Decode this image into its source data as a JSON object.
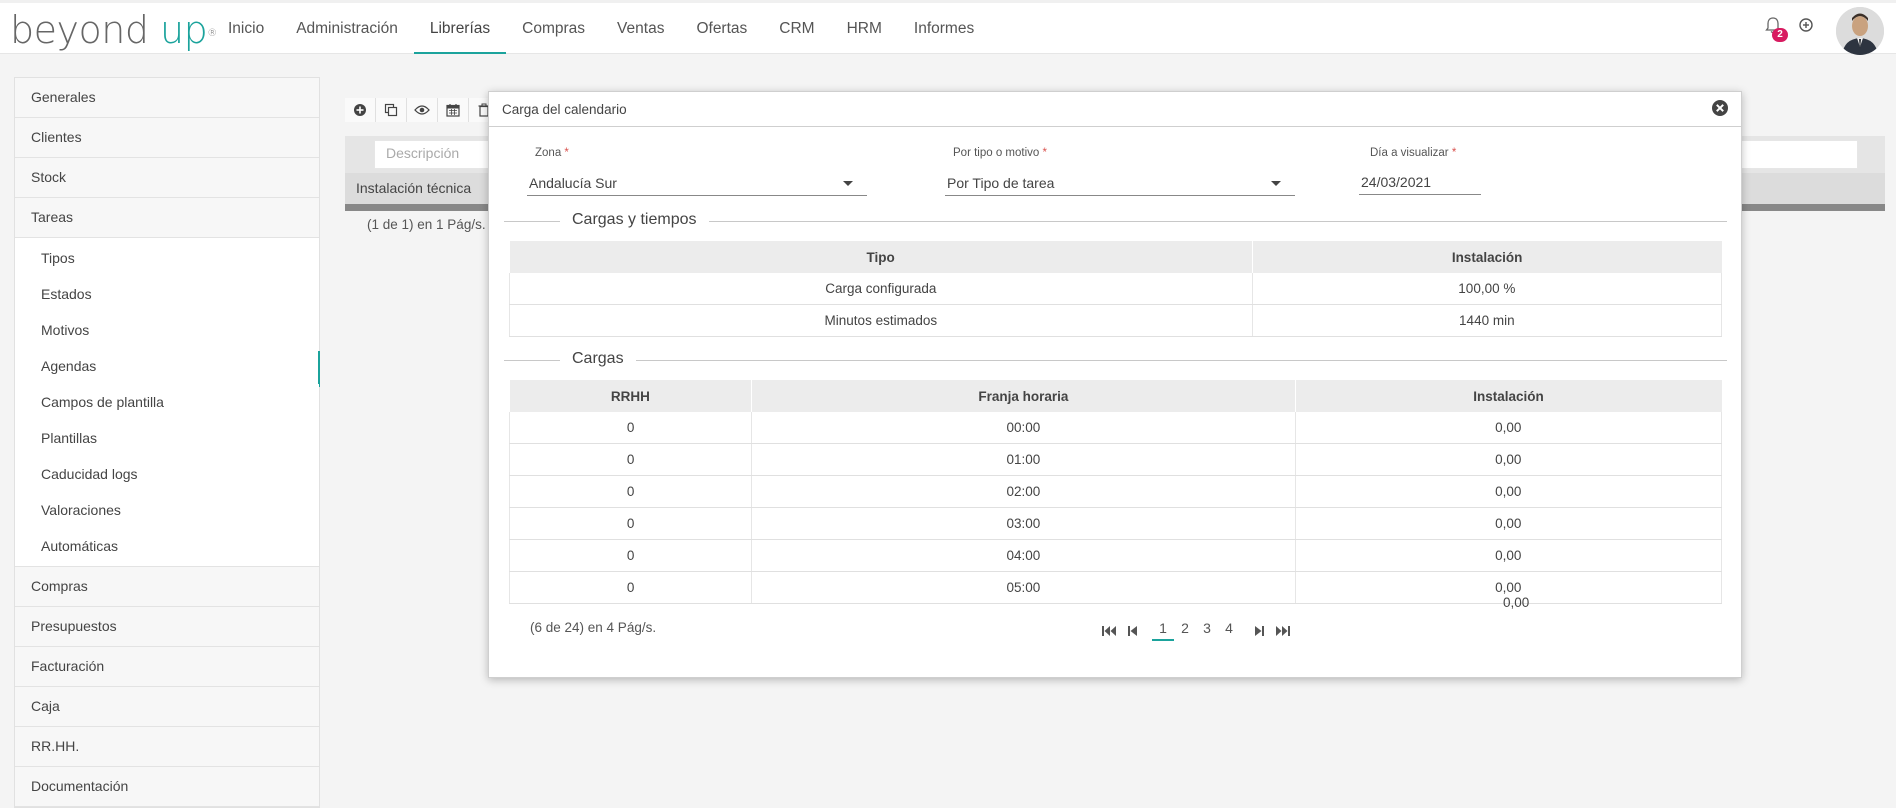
{
  "brand": {
    "part1": "beyond ",
    "part2": "up",
    "mark": "®"
  },
  "nav": {
    "items": [
      "Inicio",
      "Administración",
      "Librerías",
      "Compras",
      "Ventas",
      "Ofertas",
      "CRM",
      "HRM",
      "Informes"
    ],
    "active_index": 2
  },
  "header": {
    "notification_count": "2"
  },
  "sidebar": {
    "groups_top": [
      "Generales",
      "Clientes",
      "Stock",
      "Tareas"
    ],
    "tareas_sub": [
      "Tipos",
      "Estados",
      "Motivos",
      "Agendas",
      "Campos de plantilla",
      "Plantillas",
      "Caducidad logs",
      "Valoraciones",
      "Automáticas"
    ],
    "active_sub_index": 3,
    "groups_bottom": [
      "Compras",
      "Presupuestos",
      "Facturación",
      "Caja",
      "RR.HH.",
      "Documentación"
    ]
  },
  "background": {
    "filter_placeholder": "Descripción",
    "row_label": "Instalación técnica",
    "pager": "(1 de 1) en 1 Pág/s."
  },
  "modal": {
    "title": "Carga del calendario",
    "fields": {
      "zona_label": "Zona",
      "zona_value": "Andalucía Sur",
      "tipo_label": "Por tipo o motivo",
      "tipo_value": "Por Tipo de tarea",
      "dia_label": "Día a visualizar",
      "dia_value": "24/03/2021",
      "required_mark": "*"
    },
    "cargas_tiempos": {
      "legend": "Cargas y tiempos",
      "headers": [
        "Tipo",
        "Instalación"
      ],
      "rows": [
        [
          "Carga configurada",
          "100,00 %"
        ],
        [
          "Minutos estimados",
          "1440 min"
        ]
      ]
    },
    "cargas": {
      "legend": "Cargas",
      "headers": [
        "RRHH",
        "Franja horaria",
        "Instalación"
      ],
      "rows": [
        [
          "0",
          "00:00",
          "0,00"
        ],
        [
          "0",
          "01:00",
          "0,00"
        ],
        [
          "0",
          "02:00",
          "0,00"
        ],
        [
          "0",
          "03:00",
          "0,00"
        ],
        [
          "0",
          "04:00",
          "0,00"
        ],
        [
          "0",
          "05:00",
          "0,00"
        ]
      ],
      "total": "0,00"
    },
    "pager": {
      "info": "(6 de 24) en 4 Pág/s.",
      "pages": [
        "1",
        "2",
        "3",
        "4"
      ],
      "active_page": 0
    }
  },
  "colors": {
    "accent": "#1ba39c",
    "badge": "#d81b60"
  }
}
